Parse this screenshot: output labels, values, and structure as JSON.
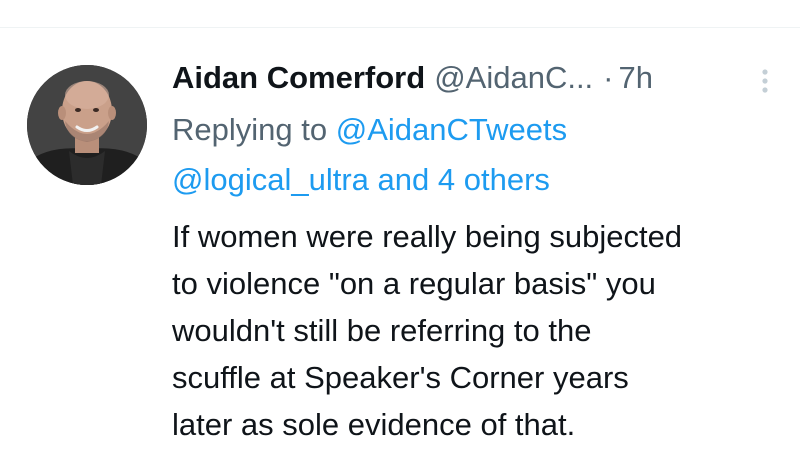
{
  "tweet": {
    "author": {
      "display_name": "Aidan Comerford",
      "handle": "@AidanC...",
      "avatar_icon": "profile-photo-bald-man"
    },
    "separator": "·",
    "timestamp": "7h",
    "more_icon": "vertical-ellipsis-icon",
    "replying": {
      "prefix": "Replying to",
      "mention1": "@AidanCTweets",
      "mention2": "@logical_ultra",
      "conjunction": "and",
      "others": "4 others"
    },
    "text_lines": [
      "If women were really being subjected",
      "to violence \"on a regular basis\" you",
      "wouldn't still be referring to the",
      "scuffle at Speaker's Corner years",
      "later as sole evidence of that."
    ]
  },
  "colors": {
    "text_primary": "#0f1419",
    "text_secondary": "#536471",
    "link": "#1d9bf0",
    "divider": "#eff3f4"
  }
}
